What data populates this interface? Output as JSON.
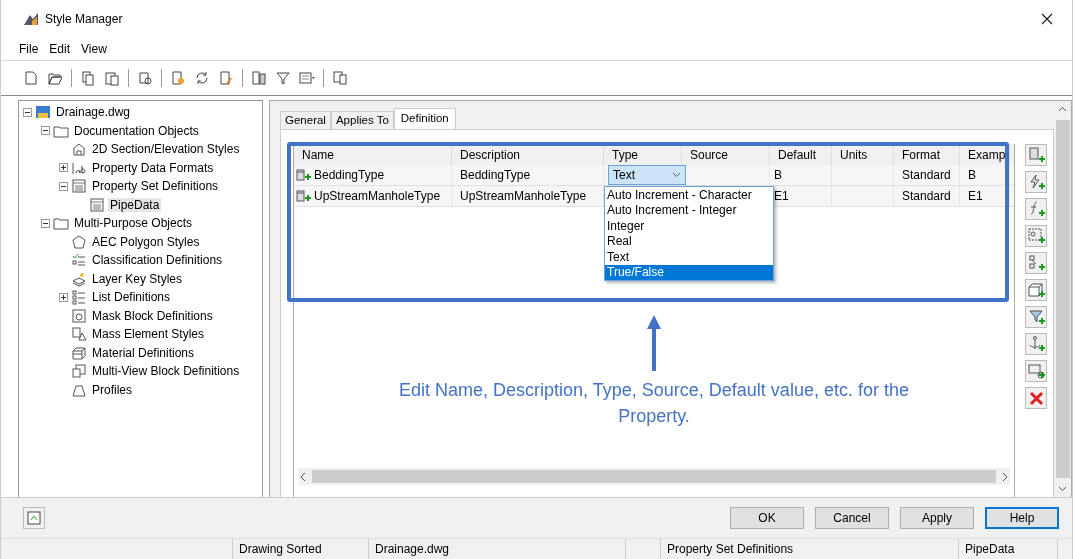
{
  "window": {
    "title": "Style Manager"
  },
  "menu": [
    "File",
    "Edit",
    "View"
  ],
  "tree": [
    {
      "label": "Drainage.dwg",
      "kind": "drawing",
      "expanded": true,
      "selected": false,
      "children": [
        {
          "label": "Documentation Objects",
          "kind": "folder",
          "expanded": true,
          "selected": false,
          "children": [
            {
              "label": "2D Section/Elevation Styles",
              "kind": "section",
              "selected": false
            },
            {
              "label": "Property Data Formats",
              "kind": "format",
              "expanded": false,
              "selected": false
            },
            {
              "label": "Property Set Definitions",
              "kind": "propset",
              "expanded": true,
              "selected": false,
              "children": [
                {
                  "label": "PipeData",
                  "kind": "propset",
                  "selected": true
                }
              ]
            }
          ]
        },
        {
          "label": "Multi-Purpose Objects",
          "kind": "folder",
          "expanded": true,
          "selected": false,
          "children": [
            {
              "label": "AEC Polygon Styles",
              "kind": "polygon",
              "selected": false
            },
            {
              "label": "Classification Definitions",
              "kind": "classification",
              "selected": false
            },
            {
              "label": "Layer Key Styles",
              "kind": "layerkey",
              "selected": false
            },
            {
              "label": "List Definitions",
              "kind": "list",
              "expanded": false,
              "selected": false
            },
            {
              "label": "Mask Block Definitions",
              "kind": "mask",
              "selected": false
            },
            {
              "label": "Mass Element Styles",
              "kind": "mass",
              "selected": false
            },
            {
              "label": "Material Definitions",
              "kind": "material",
              "selected": false
            },
            {
              "label": "Multi-View Block Definitions",
              "kind": "multiview",
              "selected": false
            },
            {
              "label": "Profiles",
              "kind": "profile",
              "selected": false
            }
          ]
        }
      ]
    }
  ],
  "tabs": [
    {
      "label": "General",
      "selected": false
    },
    {
      "label": "Applies To",
      "selected": false
    },
    {
      "label": "Definition",
      "selected": true
    }
  ],
  "table": {
    "columns": [
      "Name",
      "Description",
      "Type",
      "Source",
      "Default",
      "Units",
      "Format",
      "Examp"
    ],
    "rows": [
      {
        "name": "BeddingType",
        "description": "BeddingType",
        "type_combo": "Text",
        "default": "B",
        "format": "Standard",
        "example": "B"
      },
      {
        "name": "UpStreamManholeType",
        "description": "UpStreamManholeType",
        "default": "E1",
        "format": "Standard",
        "example": "E1"
      }
    ]
  },
  "type_dropdown": {
    "options": [
      {
        "label": "Auto Increment - Character",
        "selected": false
      },
      {
        "label": "Auto Increment - Integer",
        "selected": false
      },
      {
        "label": "Integer",
        "selected": false
      },
      {
        "label": "Real",
        "selected": false
      },
      {
        "label": "Text",
        "selected": false
      },
      {
        "label": "True/False",
        "selected": true
      }
    ]
  },
  "annotation": "Edit Name, Description, Type, Source, Default value, etc. for the Property.",
  "buttons": [
    {
      "label": "OK",
      "focused": false
    },
    {
      "label": "Cancel",
      "focused": false
    },
    {
      "label": "Apply",
      "focused": false
    },
    {
      "label": "Help",
      "focused": true
    }
  ],
  "status_bar": [
    "Drawing Sorted",
    "Drainage.dwg",
    "Property Set Definitions",
    "PipeData"
  ]
}
